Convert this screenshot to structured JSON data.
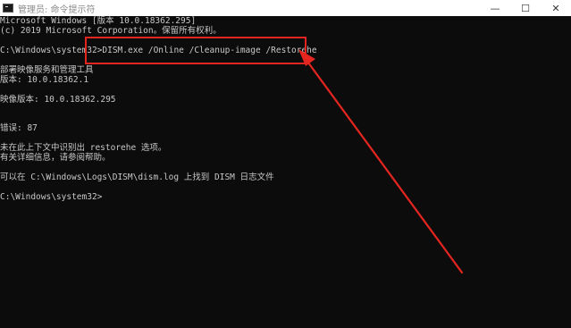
{
  "window": {
    "title": "管理员: 命令提示符",
    "minimize_glyph": "—",
    "maximize_glyph": "☐",
    "close_glyph": "✕"
  },
  "console": {
    "lines": [
      "Microsoft Windows [版本 10.0.18362.295]",
      "(c) 2019 Microsoft Corporation。保留所有权利。",
      "C:\\Windows\\system32>DISM.exe /Online /Cleanup-image /Restorehe",
      "部署映像服务和管理工具",
      "版本: 10.0.18362.1",
      "映像版本: 10.0.18362.295",
      "错误: 87",
      "未在此上下文中识别出 restorehe 选项。",
      "有关详细信息，请参阅帮助。",
      "可以在 C:\\Windows\\Logs\\DISM\\dism.log 上找到 DISM 日志文件",
      "C:\\Windows\\system32>"
    ]
  },
  "colors": {
    "console_bg": "#0c0c0c",
    "console_text": "#c8c8c8",
    "annotation_red": "#e52620"
  },
  "icons": [
    "cmd-app-icon",
    "minimize-icon",
    "maximize-icon",
    "close-icon"
  ]
}
